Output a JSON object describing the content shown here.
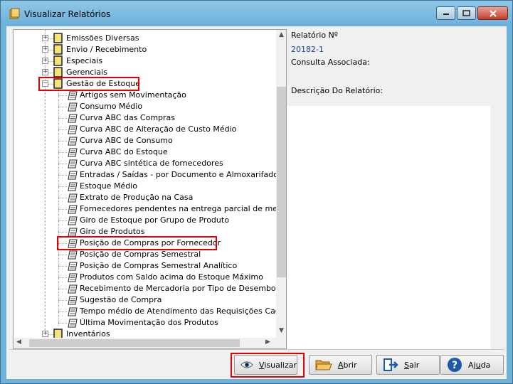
{
  "window": {
    "title": "Visualizar Relatórios"
  },
  "tree": {
    "folders_top": [
      {
        "label": "Emissões Diversas"
      },
      {
        "label": "Envio / Recebimento"
      },
      {
        "label": "Especiais"
      },
      {
        "label": "Gerenciais"
      }
    ],
    "open_folder": {
      "label": "Gestão de Estoque",
      "expander": "−"
    },
    "collapsed_expander": "+",
    "reports": [
      "Artigos sem Movimentação",
      "Consumo Médio",
      "Curva ABC das Compras",
      "Curva ABC de Alteração de Custo Médio",
      "Curva ABC de Consumo",
      "Curva ABC do Estoque",
      "Curva ABC sintética de fornecedores",
      "Entradas / Saídas - por Documento e Almoxarifado",
      "Estoque Médio",
      "Extrato de Produção na Casa",
      "Fornecedores pendentes na entrega parcial de mercadoria",
      "Giro de Estoque por Grupo de Produto",
      "Giro de Produtos",
      "Posição de Compras por Fornecedor",
      "Posição de Compras Semestral",
      "Posição de Compras Semestral Analítico",
      "Produtos com Saldo acima do Estoque Máximo",
      "Recebimento de Mercadoria por Tipo de Desembolso",
      "Sugestão de Compra",
      "Tempo médio de Atendimento das Requisições Cadastradas",
      "Última Movimentação dos Produtos"
    ],
    "folder_bottom": {
      "label": "Inventários"
    },
    "selected_report": "Posição de Compras por Fornecedor"
  },
  "info": {
    "report_no_label": "Relatório Nº",
    "report_no_value": "20182-1",
    "consulta_label": "Consulta Associada:",
    "descricao_label": "Descrição Do Relatório:"
  },
  "buttons": {
    "visualizar": {
      "pre": "",
      "u": "V",
      "post": "isualizar"
    },
    "abrir": {
      "pre": "",
      "u": "A",
      "post": "brir"
    },
    "sair": {
      "pre": "",
      "u": "S",
      "post": "air"
    },
    "ajuda": {
      "pre": "Aj",
      "u": "u",
      "post": "da"
    }
  },
  "colors": {
    "highlight": "#e00000",
    "link_blue": "#1a3fa0",
    "titlebar": "#6fb2d8"
  }
}
